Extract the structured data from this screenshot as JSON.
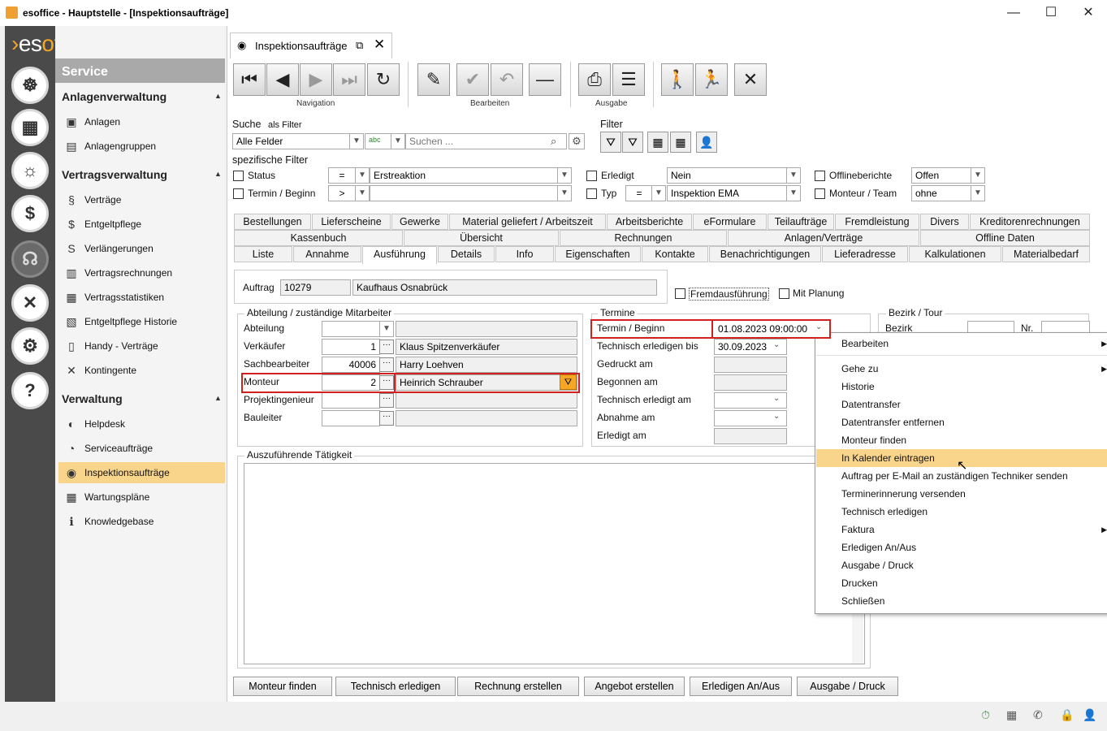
{
  "window": {
    "title": "esoffice - Hauptstelle - [Inspektionsaufträge]",
    "minimize": "—",
    "maximize": "☐",
    "close": "✕"
  },
  "brand": {
    "logo_part1": "es",
    "logo_part2": "office"
  },
  "rail": [
    {
      "icon": "helm-icon",
      "glyph": "☸"
    },
    {
      "icon": "spreadsheet-icon",
      "glyph": "▦"
    },
    {
      "icon": "alarm-light-icon",
      "glyph": "☼"
    },
    {
      "icon": "money-icon",
      "glyph": "$"
    },
    {
      "icon": "headset-icon",
      "glyph": "☊"
    },
    {
      "icon": "tools-icon",
      "glyph": "✕"
    },
    {
      "icon": "gears-icon",
      "glyph": "⚙"
    },
    {
      "icon": "help-icon",
      "glyph": "?"
    }
  ],
  "nav": {
    "header": "Service",
    "sections": [
      {
        "title": "Anlagenverwaltung",
        "items": [
          "Anlagen",
          "Anlagengruppen"
        ]
      },
      {
        "title": "Vertragsverwaltung",
        "items": [
          "Verträge",
          "Entgeltpflege",
          "Verlängerungen",
          "Vertragsrechnungen",
          "Vertragsstatistiken",
          "Entgeltpflege Historie",
          "Handy - Verträge",
          "Kontingente"
        ]
      },
      {
        "title": "Verwaltung",
        "items": [
          "Helpdesk",
          "Serviceaufträge",
          "Inspektionsaufträge",
          "Wartungspläne",
          "Knowledgebase"
        ]
      }
    ],
    "selected": "Inspektionsaufträge"
  },
  "doc_tab": {
    "label": "Inspektionsaufträge"
  },
  "toolbar": {
    "navigation_label": "Navigation",
    "edit_label": "Bearbeiten",
    "output_label": "Ausgabe"
  },
  "search": {
    "label": "Suche",
    "as_filter": "als Filter",
    "field_value": "Alle Felder",
    "placeholder": "Suchen ...",
    "filter_label": "Filter"
  },
  "specific_filters": {
    "title": "spezifische Filter",
    "status_label": "Status",
    "status_op": "=",
    "status_value": "Erstreaktion",
    "termin_label": "Termin / Beginn",
    "termin_op": ">",
    "termin_value": "",
    "erledigt_label": "Erledigt",
    "erledigt_value": "Nein",
    "typ_label": "Typ",
    "typ_op": "=",
    "typ_value": "Inspektion EMA",
    "offline_label": "Offlineberichte",
    "offline_value": "Offen",
    "monteur_label": "Monteur / Team",
    "monteur_value": "ohne"
  },
  "tabs": {
    "row1": [
      "Bestellungen",
      "Lieferscheine",
      "Gewerke",
      "Material geliefert / Arbeitszeit",
      "Arbeitsberichte",
      "eFormulare",
      "Teilaufträge",
      "Fremdleistung",
      "Divers",
      "Kreditorenrechnungen"
    ],
    "row2": [
      "Kassenbuch",
      "Übersicht",
      "Rechnungen",
      "Anlagen/Verträge",
      "Offline Daten"
    ],
    "row3": [
      "Liste",
      "Annahme",
      "Ausführung",
      "Details",
      "Info",
      "Eigenschaften",
      "Kontakte",
      "Benachrichtigungen",
      "Lieferadresse",
      "Kalkulationen",
      "Materialbedarf"
    ],
    "selected": "Ausführung"
  },
  "auftrag": {
    "label": "Auftrag",
    "number": "10279",
    "name": "Kaufhaus Osnabrück"
  },
  "checks": {
    "fremd": "Fremdausführung",
    "planung": "Mit Planung"
  },
  "staff": {
    "title": "Abteilung / zuständige Mitarbeiter",
    "rows": [
      {
        "label": "Abteilung",
        "num": "",
        "name": ""
      },
      {
        "label": "Verkäufer",
        "num": "1",
        "name": "Klaus Spitzenverkäufer"
      },
      {
        "label": "Sachbearbeiter",
        "num": "40006",
        "name": "Harry Loehven"
      },
      {
        "label": "Monteur",
        "num": "2",
        "name": "Heinrich Schrauber"
      },
      {
        "label": "Projektingenieur",
        "num": "",
        "name": ""
      },
      {
        "label": "Bauleiter",
        "num": "",
        "name": ""
      }
    ]
  },
  "termine": {
    "title": "Termine",
    "rows": [
      {
        "label": "Termin / Beginn",
        "value": "01.08.2023 09:00:00"
      },
      {
        "label": "Technisch erledigen bis",
        "value": "30.09.2023"
      },
      {
        "label": "Gedruckt am",
        "value": ""
      },
      {
        "label": "Begonnen am",
        "value": ""
      },
      {
        "label": "Technisch erledigt am",
        "value": ""
      },
      {
        "label": "Abnahme am",
        "value": ""
      },
      {
        "label": "Erledigt am",
        "value": ""
      }
    ]
  },
  "bezirk": {
    "title": "Bezirk / Tour",
    "bezirk_label": "Bezirk",
    "nr_label": "Nr."
  },
  "activity": {
    "title": "Auszuführende Tätigkeit"
  },
  "bottom_buttons": [
    "Monteur finden",
    "Technisch erledigen",
    "Rechnung erstellen",
    "Angebot erstellen",
    "Erledigen An/Aus",
    "Ausgabe / Druck"
  ],
  "context_menu": {
    "items": [
      {
        "label": "Bearbeiten",
        "submenu": true
      },
      {
        "label": "Gehe zu",
        "submenu": true
      },
      {
        "label": "Historie",
        "submenu": false
      },
      {
        "label": "Datentransfer",
        "submenu": false
      },
      {
        "label": "Datentransfer entfernen",
        "submenu": false
      },
      {
        "label": "Monteur finden",
        "submenu": false
      },
      {
        "label": "In Kalender eintragen",
        "submenu": false
      },
      {
        "label": "Auftrag per E-Mail an zuständigen Techniker senden",
        "submenu": false
      },
      {
        "label": "Terminerinnerung versenden",
        "submenu": false
      },
      {
        "label": "Technisch erledigen",
        "submenu": false
      },
      {
        "label": "Faktura",
        "submenu": true
      },
      {
        "label": "Erledigen An/Aus",
        "submenu": false
      },
      {
        "label": "Ausgabe / Druck",
        "submenu": false
      },
      {
        "label": "Drucken",
        "submenu": false
      },
      {
        "label": "Schließen",
        "submenu": false
      }
    ],
    "highlighted": "In Kalender eintragen"
  },
  "colors": {
    "accent": "#f9d58c",
    "rail": "#4a4a4a",
    "highlight_border": "#d02020"
  }
}
